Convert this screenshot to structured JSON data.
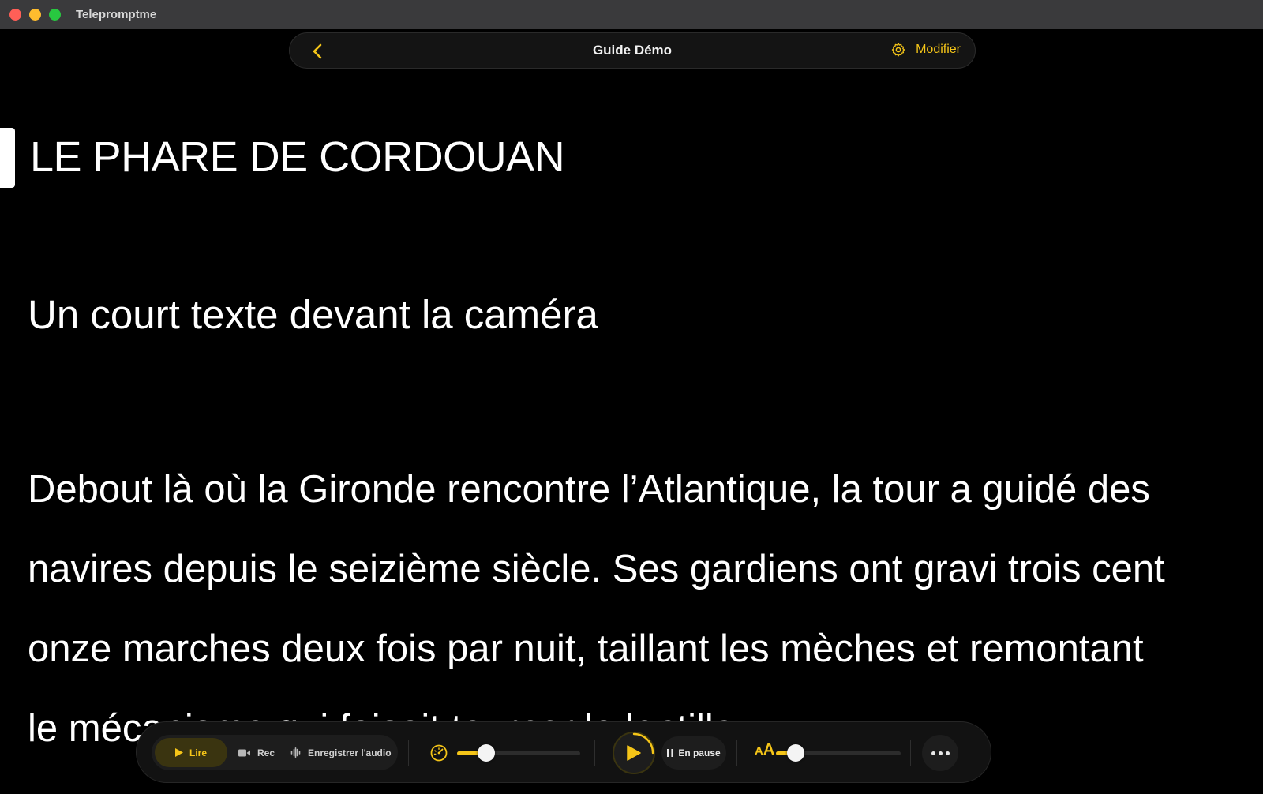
{
  "window": {
    "app_title": "Telepromptme"
  },
  "topnav": {
    "back_icon": "chevron-left-icon",
    "title": "Guide Démo",
    "edit_icon": "gear-icon",
    "edit_label": "Modifier"
  },
  "script": {
    "heading": "LE PHARE DE CORDOUAN",
    "subtitle": "Un court texte devant la caméra",
    "body_lines": [
      "Debout là où la Gironde rencontre l’Atlantique, la tour a guidé des",
      "navires depuis le seizième siècle. Ses gardiens ont gravi trois cent",
      "onze marches deux fois par nuit, taillant les mèches et remontant",
      "le mécanisme qui faisait tourner la lentille."
    ]
  },
  "controls": {
    "modes": {
      "play_label": "Lire",
      "rec_label": "Rec",
      "audio_label": "Enregistrer l'audio"
    },
    "speed": {
      "icon": "speed-gauge-icon",
      "level": 0.24
    },
    "playback": {
      "icon": "play-icon",
      "status_label": "En pause"
    },
    "font_size": {
      "icon_small": "A",
      "icon_large": "A",
      "level": 0.16
    },
    "more_icon": "ellipsis-icon"
  },
  "colors": {
    "accent": "#f5c518",
    "background": "#000000",
    "bar_background": "#121212"
  }
}
